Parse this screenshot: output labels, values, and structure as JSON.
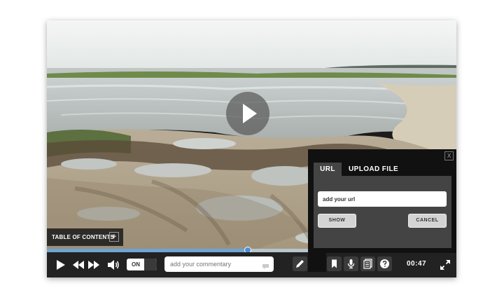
{
  "player": {
    "toc_label": "TABLE OF CONTENTS",
    "toc_toggle": "+",
    "progress_fraction": 0.49,
    "toggle_label": "ON",
    "comment_placeholder": "add your commentary",
    "time": "00:47"
  },
  "media_panel": {
    "close_label": "X",
    "tabs": [
      "URL",
      "UPLOAD FILE"
    ],
    "active_tab": "URL",
    "url_value": "add your url",
    "show_label": "SHOW",
    "cancel_label": "CANCEL"
  },
  "icons": {
    "play": "play-icon",
    "rewind": "rewind-icon",
    "fast_forward": "fast-forward-icon",
    "volume": "volume-icon",
    "comment": "speech-bubble-icon",
    "pen": "pencil-icon",
    "image": "image-icon",
    "bookmark": "bookmark-icon",
    "microphone": "microphone-icon",
    "document": "document-icon",
    "help": "help-icon",
    "fullscreen": "fullscreen-icon"
  },
  "colors": {
    "progress": "#6ea4d6",
    "controls_bg": "#222222",
    "panel_bg": "#111111"
  }
}
